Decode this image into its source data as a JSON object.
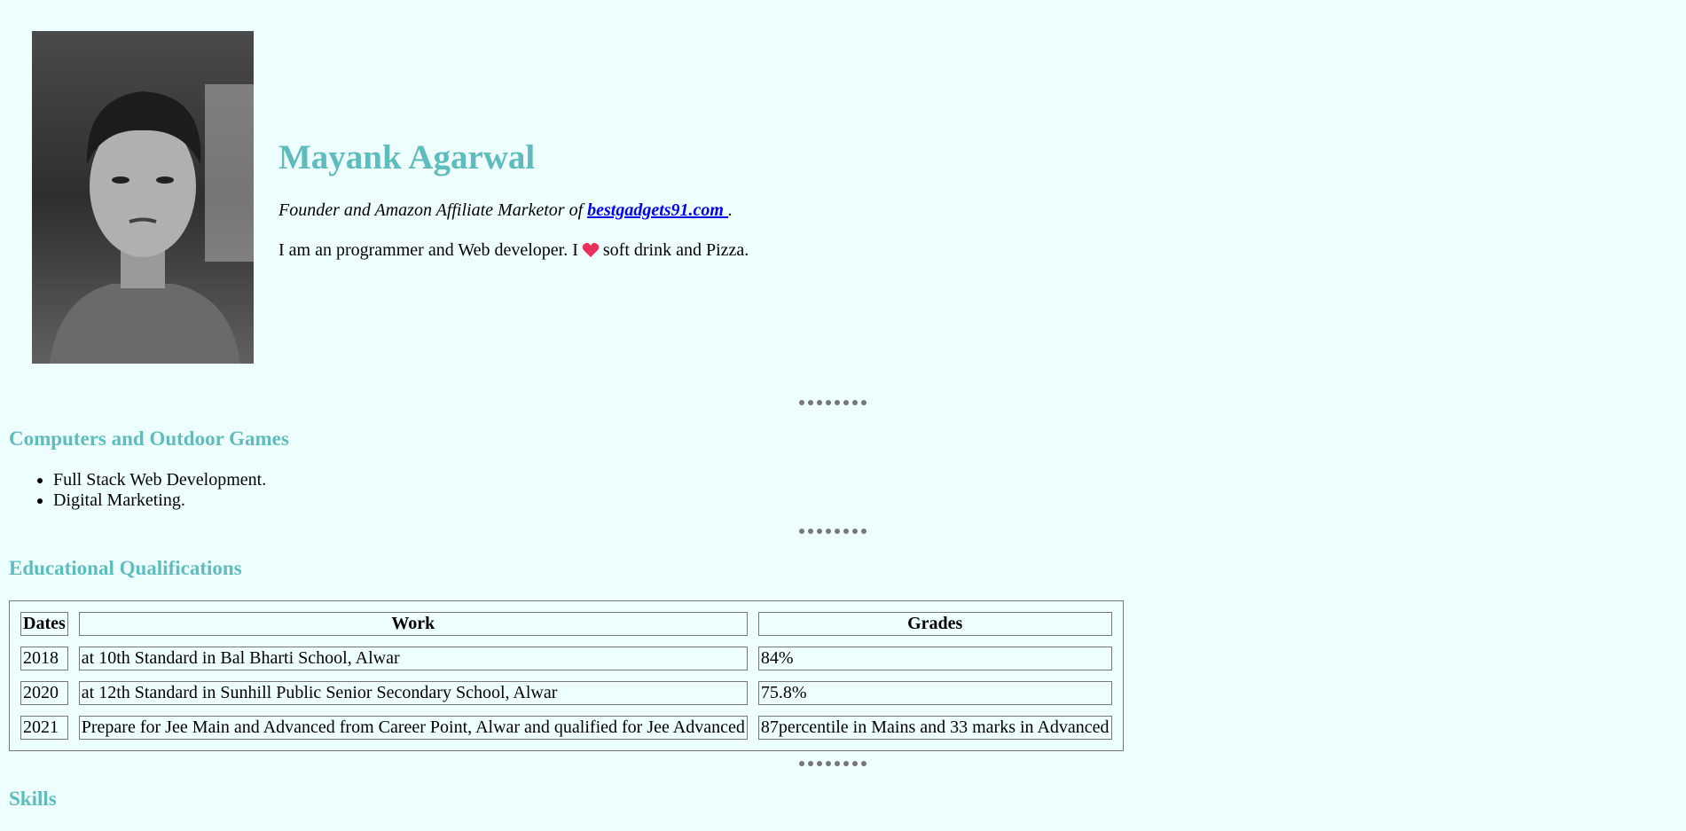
{
  "profile": {
    "name": "Mayank Agarwal",
    "tagline_prefix": "Founder and Amazon Affiliate Marketor of ",
    "site_link": "bestgadgets91.com ",
    "tagline_suffix": ".",
    "about_before": "I am an programmer and Web developer. I",
    "about_icon": "heart-icon",
    "about_after": "soft drink and Pizza."
  },
  "interests": {
    "title": "Computers and Outdoor Games",
    "items": [
      "Full Stack Web Development.",
      "Digital Marketing."
    ]
  },
  "education": {
    "title": "Educational Qualifications",
    "headers": [
      "Dates",
      "Work",
      "Grades"
    ],
    "rows": [
      [
        "2018",
        "at 10th Standard in Bal Bharti School, Alwar",
        "84%"
      ],
      [
        "2020",
        "at 12th Standard in Sunhill Public Senior Secondary School, Alwar",
        "75.8%"
      ],
      [
        "2021",
        "Prepare for Jee Main and Advanced from Career Point, Alwar and qualified for Jee Advanced",
        "87percentile in Mains and 33 marks in Advanced"
      ]
    ]
  },
  "skills": {
    "title": "Skills"
  },
  "colors": {
    "accent": "#5fbcbc",
    "background": "#eeffff",
    "link": "#0000ee",
    "heart": "#e8305a"
  }
}
